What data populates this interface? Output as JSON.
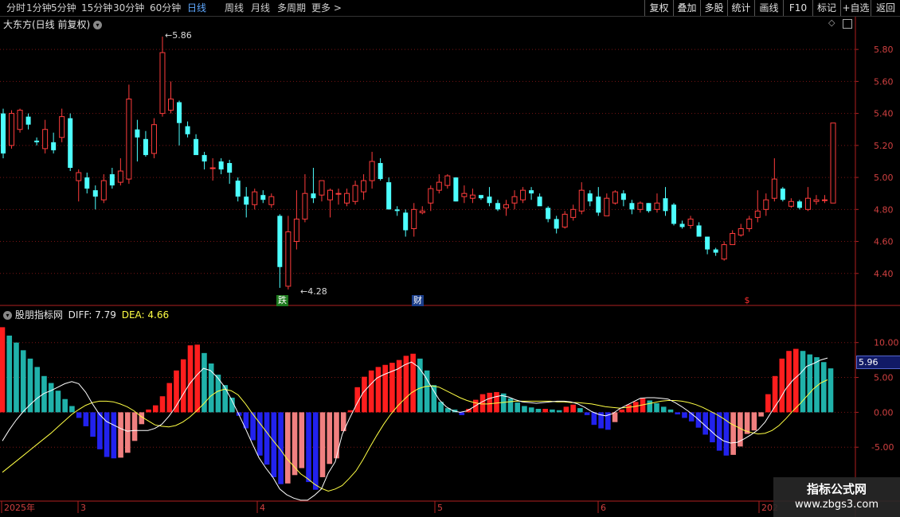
{
  "toolbar": {
    "left_items": [
      "分时",
      "1分钟",
      "5分钟",
      "15分钟",
      "30分钟",
      "60分钟",
      "日线",
      "周线",
      "月线",
      "多周期",
      "更多"
    ],
    "active_item": "日线",
    "right_items": [
      "复权",
      "叠加",
      "多股",
      "统计",
      "画线",
      "F10",
      "标记",
      "+自选",
      "返回"
    ]
  },
  "price_panel": {
    "title": "大东方(日线 前复权)",
    "high_label": "5.86",
    "low_label": "4.28",
    "badges": [
      "跌",
      "财",
      "$"
    ]
  },
  "indicator_panel": {
    "name": "股朋指标网",
    "diff_label": "DIFF: 7.79",
    "dea_label": "DEA: 4.66",
    "current_value_badge": "5.96"
  },
  "x_axis": {
    "labels": [
      "2025年",
      "3",
      "4",
      "5",
      "6",
      "202"
    ]
  },
  "watermark": {
    "title": "指标公式网",
    "url": "www.zbgs3.com"
  },
  "chart_data": [
    {
      "type": "candlestick",
      "title": "大东方(日线 前复权)",
      "ylim": [
        4.22,
        5.92
      ],
      "y_ticks": [
        "5.80",
        "5.60",
        "5.40",
        "5.20",
        "5.00",
        "4.80",
        "4.60",
        "4.40"
      ],
      "colors": {
        "up": "#ff3c3c",
        "down": "#4dffff"
      },
      "candles": [
        [
          5.4,
          5.43,
          5.12,
          5.15
        ],
        [
          5.2,
          5.42,
          5.18,
          5.4
        ],
        [
          5.3,
          5.43,
          5.28,
          5.42
        ],
        [
          5.38,
          5.4,
          5.3,
          5.33
        ],
        [
          5.23,
          5.25,
          5.2,
          5.22
        ],
        [
          5.18,
          5.36,
          5.15,
          5.3
        ],
        [
          5.22,
          5.28,
          5.15,
          5.17
        ],
        [
          5.25,
          5.43,
          5.22,
          5.38
        ],
        [
          5.37,
          5.4,
          5.04,
          5.06
        ],
        [
          4.98,
          5.05,
          4.85,
          5.03
        ],
        [
          5.0,
          5.03,
          4.9,
          4.93
        ],
        [
          4.92,
          4.95,
          4.8,
          4.88
        ],
        [
          4.86,
          5.02,
          4.84,
          4.98
        ],
        [
          5.02,
          5.06,
          4.93,
          4.95
        ],
        [
          4.97,
          5.12,
          4.95,
          5.04
        ],
        [
          4.99,
          5.58,
          4.96,
          5.49
        ],
        [
          5.3,
          5.36,
          5.1,
          5.25
        ],
        [
          5.24,
          5.29,
          5.13,
          5.14
        ],
        [
          5.15,
          5.37,
          5.12,
          5.33
        ],
        [
          5.4,
          5.88,
          5.38,
          5.78
        ],
        [
          5.42,
          5.6,
          5.4,
          5.49
        ],
        [
          5.47,
          5.48,
          5.2,
          5.34
        ],
        [
          5.32,
          5.35,
          5.25,
          5.27
        ],
        [
          5.24,
          5.27,
          5.16,
          5.14
        ],
        [
          5.14,
          5.16,
          5.05,
          5.1
        ],
        [
          5.06,
          5.12,
          4.98,
          5.06
        ],
        [
          5.1,
          5.12,
          5.02,
          5.05
        ],
        [
          5.09,
          5.11,
          4.96,
          5.03
        ],
        [
          4.98,
          5.0,
          4.85,
          4.88
        ],
        [
          4.88,
          4.94,
          4.75,
          4.83
        ],
        [
          4.83,
          4.93,
          4.8,
          4.91
        ],
        [
          4.89,
          4.92,
          4.84,
          4.86
        ],
        [
          4.83,
          4.9,
          4.81,
          4.88
        ],
        [
          4.76,
          4.77,
          4.31,
          4.44
        ],
        [
          4.32,
          4.76,
          4.3,
          4.66
        ],
        [
          4.6,
          4.92,
          4.55,
          4.74
        ],
        [
          4.74,
          5.02,
          4.72,
          4.9
        ],
        [
          4.9,
          5.06,
          4.84,
          4.87
        ],
        [
          4.89,
          4.98,
          4.85,
          4.98
        ],
        [
          4.86,
          4.93,
          4.75,
          4.92
        ],
        [
          4.9,
          4.93,
          4.83,
          4.9
        ],
        [
          4.84,
          4.93,
          4.82,
          4.9
        ],
        [
          4.85,
          4.98,
          4.83,
          4.95
        ],
        [
          4.91,
          5.02,
          4.86,
          4.98
        ],
        [
          4.98,
          5.16,
          4.93,
          5.1
        ],
        [
          5.09,
          5.12,
          4.98,
          4.99
        ],
        [
          4.97,
          5.0,
          4.8,
          4.8
        ],
        [
          4.8,
          4.82,
          4.76,
          4.79
        ],
        [
          4.78,
          4.8,
          4.63,
          4.67
        ],
        [
          4.68,
          4.84,
          4.63,
          4.8
        ],
        [
          4.78,
          4.82,
          4.77,
          4.79
        ],
        [
          4.84,
          4.95,
          4.79,
          4.93
        ],
        [
          4.92,
          5.02,
          4.9,
          4.97
        ],
        [
          4.95,
          5.02,
          4.93,
          5.01
        ],
        [
          5.0,
          5.0,
          4.85,
          4.85
        ],
        [
          4.88,
          4.95,
          4.84,
          4.9
        ],
        [
          4.87,
          4.93,
          4.84,
          4.89
        ],
        [
          4.89,
          4.89,
          4.86,
          4.87
        ],
        [
          4.88,
          4.94,
          4.82,
          4.84
        ],
        [
          4.84,
          4.86,
          4.79,
          4.8
        ],
        [
          4.81,
          4.86,
          4.76,
          4.83
        ],
        [
          4.84,
          4.92,
          4.8,
          4.88
        ],
        [
          4.86,
          4.94,
          4.84,
          4.92
        ],
        [
          4.92,
          4.94,
          4.86,
          4.9
        ],
        [
          4.88,
          4.9,
          4.83,
          4.82
        ],
        [
          4.81,
          4.82,
          4.72,
          4.74
        ],
        [
          4.74,
          4.76,
          4.65,
          4.68
        ],
        [
          4.69,
          4.79,
          4.68,
          4.77
        ],
        [
          4.75,
          4.83,
          4.73,
          4.8
        ],
        [
          4.79,
          4.97,
          4.77,
          4.92
        ],
        [
          4.9,
          4.92,
          4.82,
          4.85
        ],
        [
          4.88,
          4.94,
          4.76,
          4.78
        ],
        [
          4.76,
          4.9,
          4.76,
          4.87
        ],
        [
          4.84,
          4.92,
          4.83,
          4.91
        ],
        [
          4.9,
          4.92,
          4.82,
          4.86
        ],
        [
          4.84,
          4.86,
          4.77,
          4.8
        ],
        [
          4.8,
          4.85,
          4.78,
          4.84
        ],
        [
          4.84,
          4.84,
          4.78,
          4.79
        ],
        [
          4.8,
          4.9,
          4.78,
          4.84
        ],
        [
          4.87,
          4.94,
          4.76,
          4.79
        ],
        [
          4.83,
          4.84,
          4.7,
          4.71
        ],
        [
          4.71,
          4.73,
          4.68,
          4.69
        ],
        [
          4.7,
          4.76,
          4.68,
          4.74
        ],
        [
          4.7,
          4.72,
          4.63,
          4.63
        ],
        [
          4.63,
          4.63,
          4.52,
          4.55
        ],
        [
          4.55,
          4.56,
          4.51,
          4.53
        ],
        [
          4.49,
          4.6,
          4.48,
          4.58
        ],
        [
          4.58,
          4.67,
          4.58,
          4.65
        ],
        [
          4.64,
          4.71,
          4.63,
          4.68
        ],
        [
          4.68,
          4.76,
          4.66,
          4.74
        ],
        [
          4.75,
          4.92,
          4.72,
          4.79
        ],
        [
          4.8,
          4.9,
          4.76,
          4.86
        ],
        [
          4.87,
          5.12,
          4.85,
          4.99
        ],
        [
          4.93,
          4.94,
          4.85,
          4.86
        ],
        [
          4.82,
          4.87,
          4.81,
          4.85
        ],
        [
          4.85,
          4.86,
          4.8,
          4.81
        ],
        [
          4.8,
          4.94,
          4.79,
          4.87
        ],
        [
          4.85,
          4.89,
          4.83,
          4.86
        ],
        [
          4.86,
          4.89,
          4.84,
          4.86
        ],
        [
          4.84,
          5.34,
          4.84,
          5.34
        ]
      ],
      "annotations": {
        "high": 5.86,
        "low": 4.28
      }
    },
    {
      "type": "bar+line",
      "title": "股朋指标网",
      "ylim": [
        -12.5,
        13.5
      ],
      "y_ticks": [
        "10.00",
        "5.00",
        "0.00",
        "-5.00"
      ],
      "colors": {
        "rising_positive": "#ff1e1e",
        "falling_positive": "#20b2aa",
        "falling_negative": "#2222ee",
        "rising_negative": "#f08080",
        "diff": "#ffffff",
        "dea": "#ffff44"
      },
      "histogram": [
        12.2,
        11.0,
        10.0,
        8.9,
        7.7,
        6.5,
        5.2,
        4.2,
        3.1,
        1.9,
        0.9,
        -0.8,
        -2.0,
        -3.5,
        -5.3,
        -6.4,
        -6.6,
        -6.5,
        -5.8,
        -4.1,
        -1.7,
        0.4,
        1.0,
        2.3,
        4.2,
        6.0,
        7.6,
        9.6,
        9.7,
        8.5,
        7.0,
        5.4,
        3.9,
        2.1,
        -0.5,
        -2.3,
        -4.0,
        -6.2,
        -7.5,
        -9.3,
        -10.3,
        -10.2,
        -9.0,
        -8.0,
        -10.0,
        -11.1,
        -9.3,
        -7.4,
        -6.6,
        -2.7,
        0.3,
        3.6,
        5.1,
        6.0,
        6.5,
        6.8,
        7.1,
        7.5,
        8.1,
        8.4,
        7.7,
        6.0,
        3.9,
        1.5,
        0.6,
        0.4,
        -0.4,
        0.5,
        1.8,
        2.6,
        2.8,
        2.9,
        2.7,
        2.0,
        1.4,
        0.9,
        0.7,
        0.5,
        0.5,
        0.4,
        0.3,
        0.8,
        1.1,
        0.6,
        -0.4,
        -1.8,
        -2.3,
        -2.5,
        -1.4,
        0.4,
        1.1,
        1.5,
        2.0,
        1.7,
        1.3,
        0.8,
        0.4,
        -0.3,
        -0.8,
        -1.3,
        -2.2,
        -3.2,
        -4.3,
        -5.5,
        -6.2,
        -6.1,
        -4.9,
        -3.1,
        -2.6,
        -0.6,
        2.6,
        5.2,
        7.7,
        8.8,
        9.1,
        8.8,
        8.3,
        7.9,
        7.2,
        6.3
      ],
      "diff": [
        -4.1,
        -2.5,
        -1.1,
        0.1,
        1.1,
        2.0,
        2.7,
        3.1,
        3.6,
        4.1,
        4.4,
        4.1,
        2.9,
        1.2,
        -0.3,
        -1.3,
        -1.8,
        -2.3,
        -2.7,
        -2.6,
        -2.6,
        -2.6,
        -2.3,
        -1.7,
        -0.6,
        0.8,
        2.5,
        4.1,
        5.3,
        6.3,
        6.0,
        5.0,
        3.7,
        1.9,
        -0.1,
        -2.2,
        -4.4,
        -6.5,
        -8.0,
        -9.3,
        -11.0,
        -11.8,
        -12.3,
        -12.6,
        -12.6,
        -11.9,
        -11.0,
        -8.7,
        -7.1,
        -3.2,
        -1.0,
        1.0,
        2.8,
        3.9,
        4.9,
        5.4,
        5.8,
        6.2,
        6.8,
        7.2,
        6.5,
        5.1,
        3.4,
        1.8,
        0.8,
        0.2,
        0.0,
        0.2,
        0.8,
        1.4,
        1.9,
        2.2,
        2.4,
        2.2,
        1.8,
        1.5,
        1.4,
        1.3,
        1.4,
        1.5,
        1.6,
        1.6,
        1.5,
        1.2,
        0.7,
        0.1,
        -0.3,
        -0.5,
        -0.2,
        0.5,
        1.0,
        1.5,
        2.0,
        2.1,
        2.1,
        2.0,
        1.9,
        1.4,
        0.8,
        0.1,
        -0.7,
        -1.6,
        -2.5,
        -3.4,
        -4.1,
        -4.4,
        -4.3,
        -3.8,
        -3.2,
        -2.5,
        -1.4,
        0.2,
        1.7,
        3.4,
        4.6,
        5.5,
        6.6,
        7.0,
        7.5,
        7.79
      ],
      "dea": [
        -8.6,
        -7.8,
        -7.0,
        -6.2,
        -5.4,
        -4.6,
        -3.8,
        -3.0,
        -2.1,
        -1.2,
        -0.3,
        0.4,
        1.0,
        1.4,
        1.6,
        1.6,
        1.5,
        1.2,
        0.8,
        0.2,
        -0.6,
        -1.2,
        -1.8,
        -2.0,
        -2.1,
        -1.9,
        -1.4,
        -0.7,
        0.2,
        1.2,
        2.3,
        3.0,
        3.3,
        3.1,
        2.5,
        1.3,
        -0.1,
        -1.4,
        -2.7,
        -4.0,
        -5.2,
        -6.6,
        -7.7,
        -8.8,
        -9.5,
        -10.3,
        -10.9,
        -11.3,
        -11.0,
        -10.5,
        -9.5,
        -8.4,
        -6.8,
        -5.0,
        -3.3,
        -1.7,
        -0.3,
        0.9,
        1.9,
        2.8,
        3.4,
        3.7,
        3.8,
        3.6,
        3.1,
        2.6,
        2.1,
        1.7,
        1.4,
        1.2,
        1.2,
        1.3,
        1.4,
        1.5,
        1.6,
        1.6,
        1.6,
        1.6,
        1.6,
        1.6,
        1.5,
        1.5,
        1.4,
        1.4,
        1.3,
        1.2,
        1.0,
        0.8,
        0.7,
        0.6,
        0.7,
        0.8,
        1.0,
        1.2,
        1.4,
        1.6,
        1.7,
        1.7,
        1.6,
        1.4,
        1.1,
        0.7,
        0.2,
        -0.3,
        -0.9,
        -1.6,
        -2.1,
        -2.6,
        -2.9,
        -3.1,
        -3.0,
        -2.6,
        -1.9,
        -0.9,
        0.2,
        1.2,
        2.3,
        3.4,
        4.2,
        4.66
      ]
    }
  ]
}
